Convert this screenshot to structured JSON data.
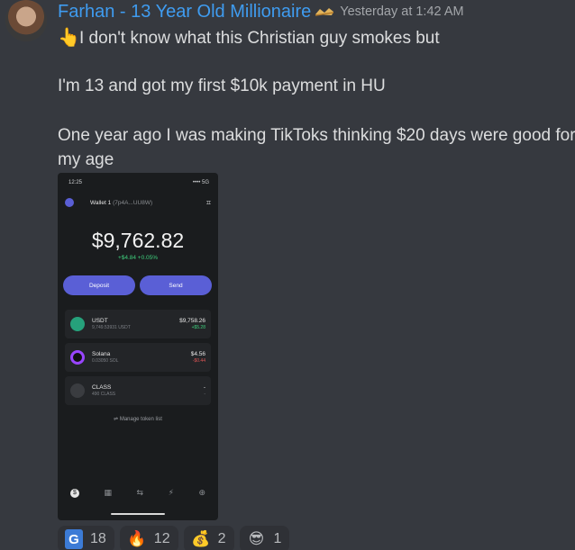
{
  "message": {
    "username": "Farhan - 13 Year Old Millionaire",
    "timestamp": "Yesterday at 1:42 AM",
    "badge_icon": "crown-icon",
    "lines": [
      "I don't know what this Christian guy smokes but",
      "I'm 13 and got my first $10k payment in HU",
      "One year ago I was making TikToks thinking $20 days were good for",
      "my age"
    ],
    "lead_emoji": "👆"
  },
  "phone": {
    "time": "12:25",
    "status": "•••• 5G",
    "wallet_label": "Wallet 1",
    "wallet_addr": "(7p4A...UU8W)",
    "balance": "$9,762.82",
    "change": "+$4.84  +0.05%",
    "deposit_label": "Deposit",
    "send_label": "Send",
    "tokens": [
      {
        "name": "USDT",
        "sub": "9,749.53931 USDT",
        "value": "$9,758.26",
        "change": "+$5.28",
        "color": "#26a17b",
        "change_color": "#3fcf7d"
      },
      {
        "name": "Solana",
        "sub": "0.03050 SOL",
        "value": "$4.56",
        "change": "-$0.44",
        "color": "#9945ff",
        "change_color": "#e05555"
      },
      {
        "name": "CLASS",
        "sub": "490 CLASS",
        "value": "-",
        "change": "-",
        "color": "#3a3c40",
        "change_color": "#7d8086"
      }
    ],
    "manage_label": "Manage token list",
    "nav_icons": [
      "dollar-icon",
      "grid-icon",
      "swap-icon",
      "bolt-icon",
      "globe-icon"
    ]
  },
  "reactions": [
    {
      "emoji": "G",
      "count": "18",
      "icon": "g-badge-icon"
    },
    {
      "emoji": "🔥",
      "count": "12",
      "icon": "fire-icon"
    },
    {
      "emoji": "💰",
      "count": "2",
      "icon": "money-bag-icon"
    },
    {
      "emoji": "😎",
      "count": "1",
      "icon": "sunglasses-face-icon"
    }
  ]
}
